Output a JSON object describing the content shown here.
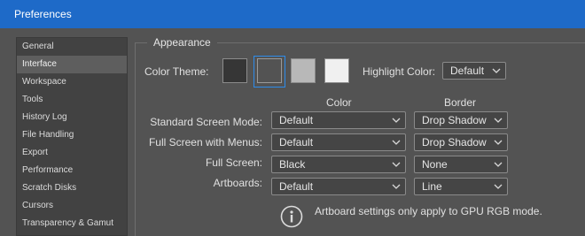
{
  "window": {
    "title": "Preferences"
  },
  "sidebar": {
    "items": [
      {
        "label": "General"
      },
      {
        "label": "Interface"
      },
      {
        "label": "Workspace"
      },
      {
        "label": "Tools"
      },
      {
        "label": "History Log"
      },
      {
        "label": "File Handling"
      },
      {
        "label": "Export"
      },
      {
        "label": "Performance"
      },
      {
        "label": "Scratch Disks"
      },
      {
        "label": "Cursors"
      },
      {
        "label": "Transparency & Gamut"
      }
    ],
    "selected": "Interface"
  },
  "appearance": {
    "group_title": "Appearance",
    "color_theme_label": "Color Theme:",
    "themes": [
      {
        "name": "theme-darkest",
        "color": "#363636"
      },
      {
        "name": "theme-dark",
        "color": "#535353"
      },
      {
        "name": "theme-medium-light",
        "color": "#b8b8b8"
      },
      {
        "name": "theme-light",
        "color": "#f0f0f0"
      }
    ],
    "selected_theme_index": 1,
    "highlight_color_label": "Highlight Color:",
    "highlight_color_value": "Default",
    "col_color": "Color",
    "col_border": "Border",
    "rows": [
      {
        "label": "Standard Screen Mode:",
        "color": "Default",
        "border": "Drop Shadow"
      },
      {
        "label": "Full Screen with Menus:",
        "color": "Default",
        "border": "Drop Shadow"
      },
      {
        "label": "Full Screen:",
        "color": "Black",
        "border": "None"
      },
      {
        "label": "Artboards:",
        "color": "Default",
        "border": "Line"
      }
    ],
    "info_text": "Artboard settings only apply to GPU RGB mode."
  },
  "colors": {
    "titlebar": "#1e6ac8",
    "accent": "#2d8ceb",
    "panel_bg": "#535353"
  }
}
